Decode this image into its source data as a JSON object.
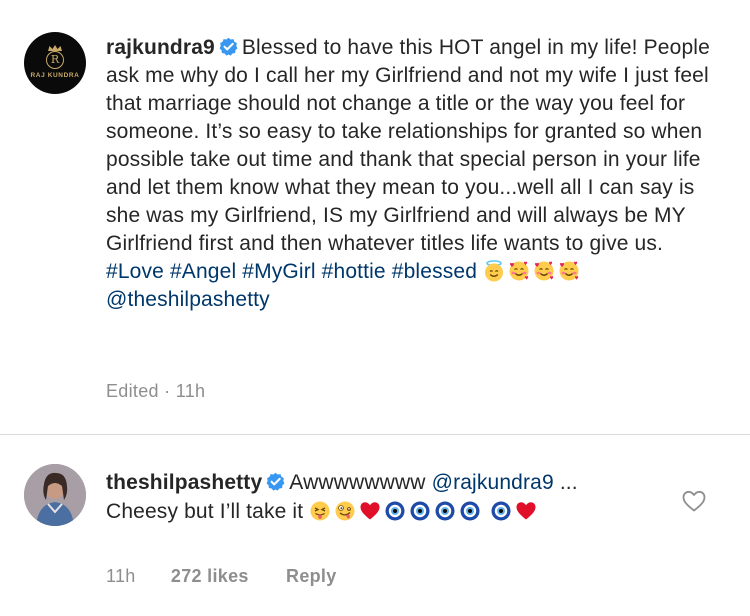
{
  "post_caption": {
    "avatar_brand_text": "RAJ KUNDRA",
    "avatar_monogram": "R",
    "username": "rajkundra9",
    "text": "Blessed to have this HOT angel in my life! People ask me why do I call her my Girlfriend and not my wife I just feel that marriage should not change a title or the way you feel for someone. It’s so easy to take relationships for granted so when possible take out time and thank that special person in your life and let them know what they mean to you...well all I can say is she was my Girlfriend, IS my Girlfriend and will always be MY Girlfriend first and then whatever titles life wants to give us.",
    "hashtags": {
      "love": "#Love",
      "angel": "#Angel",
      "mygirl": "#MyGirl",
      "hottie": "#hottie",
      "blessed": "#blessed"
    },
    "emojis": [
      "smiling-face-with-halo",
      "smiling-face-with-hearts",
      "smiling-face-with-hearts",
      "smiling-face-with-hearts"
    ],
    "mention": "@theshilpashetty",
    "status": "Edited · 11h"
  },
  "comment": {
    "username": "theshilpashetty",
    "text_before_mention": "Awwwwwwww",
    "mention": "@rajkundra9",
    "text_after": "... Cheesy but I’ll take it",
    "emojis": [
      "winking-face-with-tongue",
      "zany-face",
      "red-heart",
      "nazar-amulet",
      "nazar-amulet",
      "nazar-amulet",
      "nazar-amulet",
      "nazar-amulet",
      "red-heart"
    ],
    "time": "11h",
    "likes": "272 likes",
    "reply_label": "Reply"
  },
  "colors": {
    "text": "#262626",
    "link": "#00376b",
    "muted": "#8e8e8e",
    "verified": "#3897f0",
    "divider": "#dbdbdb",
    "avatar_gold": "#c9a968"
  }
}
